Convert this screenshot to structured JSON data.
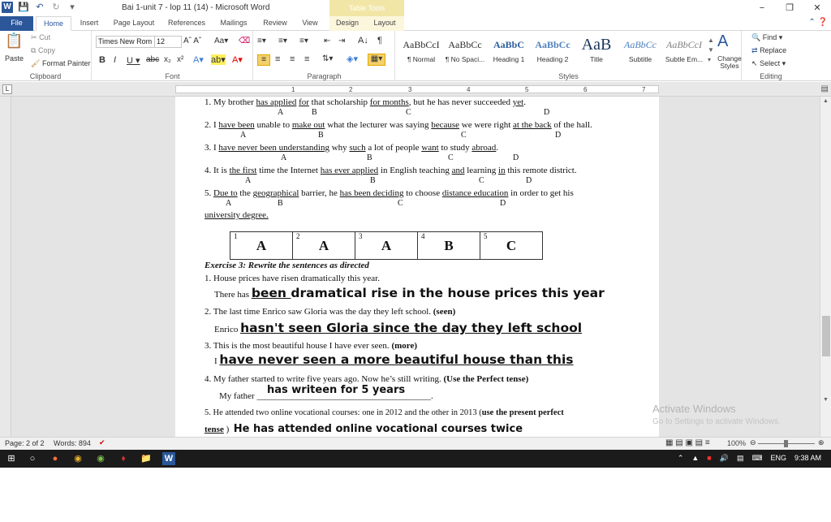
{
  "window": {
    "title": "Bai 1-unit 7 - lop 11 (14) - Microsoft Word",
    "table_tools": "Table Tools",
    "controls": [
      "−",
      "❐",
      "✕"
    ]
  },
  "tabs": {
    "file": "File",
    "home": "Home",
    "insert": "Insert",
    "page_layout": "Page Layout",
    "references": "References",
    "mailings": "Mailings",
    "review": "Review",
    "view": "View",
    "design": "Design",
    "layout": "Layout"
  },
  "clipboard": {
    "paste": "Paste",
    "cut": "Cut",
    "copy": "Copy",
    "format_painter": "Format Painter",
    "label": "Clipboard"
  },
  "font": {
    "name": "Times New Rom",
    "size": "12",
    "label": "Font"
  },
  "paragraph": {
    "label": "Paragraph"
  },
  "styles": {
    "label": "Styles",
    "items": [
      {
        "sample": "AaBbCcI",
        "name": "¶ Normal"
      },
      {
        "sample": "AaBbCc",
        "name": "¶ No Spaci..."
      },
      {
        "sample": "AaBbC",
        "name": "Heading 1"
      },
      {
        "sample": "AaBbCc",
        "name": "Heading 2"
      },
      {
        "sample": "AaB",
        "name": "Title"
      },
      {
        "sample": "AaBbCc",
        "name": "Subtitle"
      },
      {
        "sample": "AaBbCcI",
        "name": "Subtle Em..."
      }
    ],
    "change_styles": "Change Styles"
  },
  "editing": {
    "find": "Find",
    "replace": "Replace",
    "select": "Select",
    "label": "Editing"
  },
  "ruler": {
    "numbers": [
      "1",
      "2",
      "3",
      "4",
      "5",
      "6",
      "7"
    ]
  },
  "doc": {
    "q1": {
      "n": "1. My brother ",
      "a": "has applied",
      "s1": " ",
      "b": "for",
      "s2": " that scholarship ",
      "c": "for months",
      "s3": ", but he has never succeeded ",
      "d": "yet",
      "end": "."
    },
    "q2": {
      "n": "2. I ",
      "a": "have been",
      "s1": " unable to ",
      "b": "make out",
      "s2": " what the lecturer was saying ",
      "c": "because",
      "s3": " we were right ",
      "d": "at the back",
      "end": " of the hall."
    },
    "q3": {
      "n": "3. I ",
      "a": "have never been understanding",
      "s1": " why ",
      "b": "such",
      "s2": " a lot of people ",
      "c": "want",
      "s3": " to study ",
      "d": "abroad",
      "end": "."
    },
    "q4": {
      "n": "4. It is ",
      "a": "the first",
      "s1": " time the Internet ",
      "b": "has ever applied",
      "s2": " in English teaching ",
      "c": "and",
      "s3": " learning ",
      "d": "in",
      "end": " this remote district."
    },
    "q5": {
      "n": "5. ",
      "a": "Due to",
      "s1": " the ",
      "b": "geographical",
      "s2": " barrier, he ",
      "c": "has been deciding",
      "s3": " to choose ",
      "d": "distance education",
      "end": " in order to get his",
      "cont": "university degree."
    },
    "letters": {
      "a": "A",
      "b": "B",
      "c": "C",
      "d": "D"
    },
    "answer_key": [
      {
        "num": "1",
        "ans": "A"
      },
      {
        "num": "2",
        "ans": "A"
      },
      {
        "num": "3",
        "ans": "A"
      },
      {
        "num": "4",
        "ans": "B"
      },
      {
        "num": "5",
        "ans": "C"
      }
    ],
    "ex3_title": "Exercise 3: Rewrite the sentences as directed",
    "e1": {
      "q": "1. House prices have risen dramatically this year.",
      "prefix": "There has ",
      "ans_a": " been ",
      "ans_b": " dramatical rise in the house prices this year"
    },
    "e2": {
      "q": "2. The last time Enrico saw Gloria was the day they left school. ",
      "hint": "(seen)",
      "prefix": "Enrico ",
      "ans": "hasn't seen Gloria since the day they left school"
    },
    "e3": {
      "q": "3. This is the most beautiful house I have ever seen. ",
      "hint": "(more)",
      "prefix": "I ",
      "ans": "have never seen a more beautiful house than this"
    },
    "e4": {
      "q": "4. My father started to write five years ago. Now he’s still writing. ",
      "hint": "(Use the Perfect tense)",
      "prefix": "My father ",
      "ans": "has writeen for 5 years",
      "blank": "_______________________________________."
    },
    "e5": {
      "q": "5. He attended two online vocational courses: one in 2012 and the other in 2013 (",
      "hint": "use the present perfect",
      "hint2": "tense",
      "close": " )",
      "ans": "He has attended online vocational courses twice"
    }
  },
  "watermark": {
    "line1": "Activate Windows",
    "line2": "Go to Settings to activate Windows."
  },
  "status": {
    "page": "Page: 2 of 2",
    "words": "Words: 894",
    "zoom": "100%"
  },
  "taskbar": {
    "lang": "ENG",
    "time": "9:38 AM"
  },
  "colors": {
    "accent": "#2b579a",
    "table_tools": "#f1e6a6",
    "taskbar": "#1b1b1b"
  }
}
